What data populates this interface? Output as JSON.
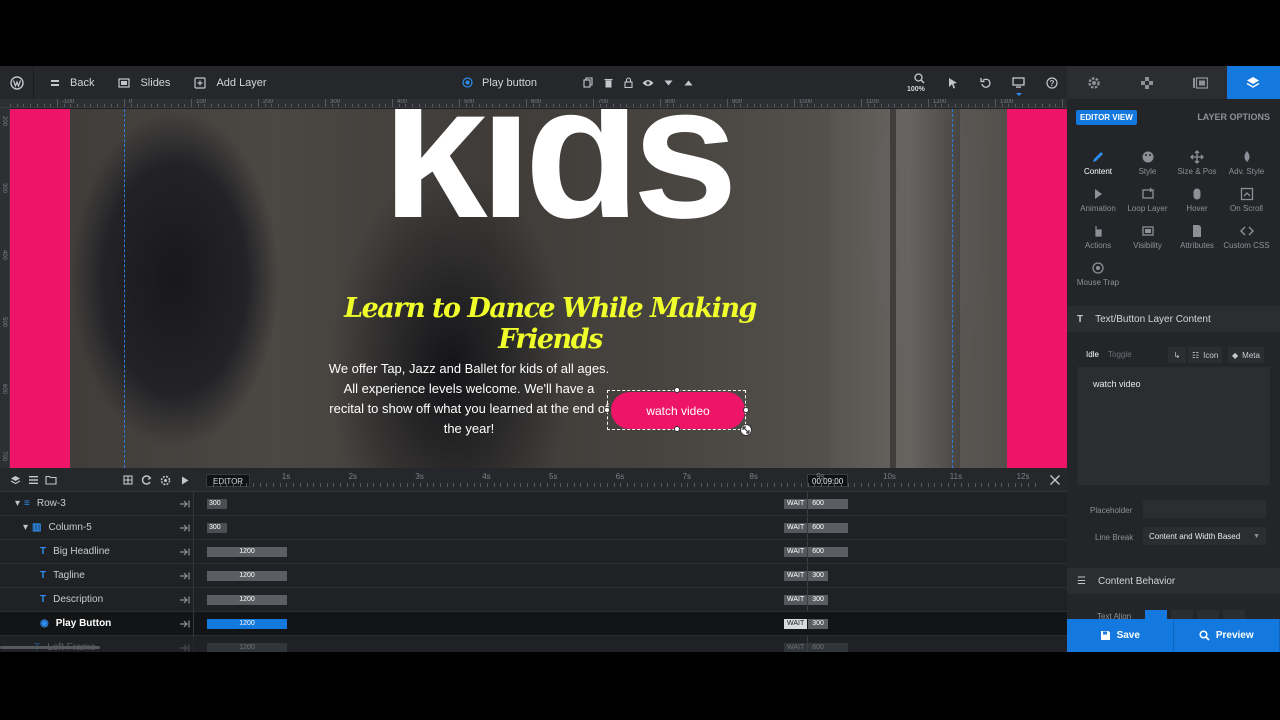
{
  "toolbar": {
    "back_label": "Back",
    "slides_label": "Slides",
    "add_layer_label": "Add Layer",
    "selected_layer_label": "Play button",
    "zoom_label": "100%"
  },
  "ruler": {
    "h_labels": [
      "-100",
      "0",
      "100",
      "200",
      "300",
      "400",
      "500",
      "600",
      "700",
      "800",
      "900",
      "1000",
      "1100",
      "1200",
      "1300"
    ],
    "v_labels": [
      "200",
      "300",
      "400",
      "500",
      "600",
      "700"
    ]
  },
  "canvas": {
    "headline": "kids",
    "tagline": "Learn to Dance While Making Friends",
    "description": "We offer Tap, Jazz and Ballet for kids of all ages. All experience levels welcome. We'll have a recital to show off what you learned at the end of the year!",
    "button_label": "watch video",
    "accent_pink": "#ee1468",
    "tagline_color": "#f0ff2a"
  },
  "timeline": {
    "editor_label": "EDITOR",
    "current_time": "00:09:00",
    "seconds": [
      "1s",
      "2s",
      "3s",
      "4s",
      "5s",
      "6s",
      "7s",
      "8s",
      "9s",
      "10s",
      "11s",
      "12s"
    ],
    "rows": [
      {
        "name": "Row-3",
        "start": "300",
        "wait": "WAIT",
        "end": "600"
      },
      {
        "name": "Column-5",
        "start": "300",
        "wait": "WAIT",
        "end": "600"
      },
      {
        "name": "Big Headline",
        "start": "1200",
        "wait": "WAIT",
        "end": "600"
      },
      {
        "name": "Tagline",
        "start": "1200",
        "wait": "WAIT",
        "end": "300"
      },
      {
        "name": "Description",
        "start": "1200",
        "wait": "WAIT",
        "end": "300"
      },
      {
        "name": "Play Button",
        "start": "1200",
        "wait": "WAIT",
        "end": "300"
      },
      {
        "name": "Left Frame",
        "start": "1200",
        "wait": "WAIT",
        "end": "600"
      }
    ]
  },
  "panel": {
    "editor_view_label": "EDITOR VIEW",
    "layer_options_label": "LAYER OPTIONS",
    "options": [
      {
        "label": "Content",
        "icon": "pen-icon"
      },
      {
        "label": "Style",
        "icon": "palette-icon"
      },
      {
        "label": "Size & Pos",
        "icon": "move-icon"
      },
      {
        "label": "Adv. Style",
        "icon": "drop-icon"
      },
      {
        "label": "Animation",
        "icon": "play-icon"
      },
      {
        "label": "Loop Layer",
        "icon": "loop-icon"
      },
      {
        "label": "Hover",
        "icon": "mouse-icon"
      },
      {
        "label": "On Scroll",
        "icon": "scroll-icon"
      },
      {
        "label": "Actions",
        "icon": "hand-icon"
      },
      {
        "label": "Visibility",
        "icon": "eye-icon"
      },
      {
        "label": "Attributes",
        "icon": "file-icon"
      },
      {
        "label": "Custom CSS",
        "icon": "code-icon"
      },
      {
        "label": "Mouse Trap",
        "icon": "target-icon"
      }
    ],
    "content_section_title": "Text/Button Layer Content",
    "idle_tab": "Idle",
    "toggle_tab": "Toggle",
    "icon_button": "Icon",
    "meta_button": "Meta",
    "content_text": "watch video",
    "placeholder_label": "Placeholder",
    "placeholder_value": "",
    "line_break_label": "Line Break",
    "line_break_value": "Content and Width Based",
    "content_behavior_title": "Content Behavior",
    "text_align_label": "Text Align",
    "save_label": "Save",
    "preview_label": "Preview"
  }
}
